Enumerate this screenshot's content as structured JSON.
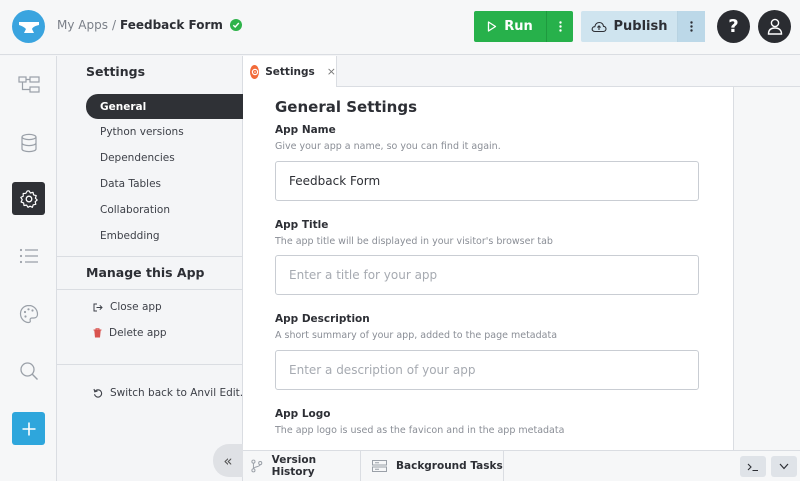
{
  "header": {
    "breadcrumb_root": "My Apps",
    "breadcrumb_sep": "/",
    "app_name": "Feedback Form",
    "run_label": "Run",
    "publish_label": "Publish",
    "help_label": "?"
  },
  "rail": {
    "icons": [
      "app-tree-icon",
      "database-icon",
      "gear-icon",
      "list-icon",
      "palette-icon",
      "search-icon",
      "plus-icon"
    ],
    "active": "gear-icon"
  },
  "nav": {
    "title": "Settings",
    "items": [
      {
        "label": "General",
        "active": true
      },
      {
        "label": "Python versions"
      },
      {
        "label": "Dependencies"
      },
      {
        "label": "Data Tables"
      },
      {
        "label": "Collaboration"
      },
      {
        "label": "Embedding"
      }
    ],
    "manage_title": "Manage this App",
    "close_app": "Close app",
    "delete_app": "Delete app",
    "switch_back": "Switch back to Anvil Edit..."
  },
  "tab": {
    "label": "Settings",
    "close": "×"
  },
  "main": {
    "heading": "General Settings",
    "app_name_label": "App Name",
    "app_name_help": "Give your app a name, so you can find it again.",
    "app_name_value": "Feedback Form",
    "app_title_label": "App Title",
    "app_title_help": "The app title will be displayed in your visitor's browser tab",
    "app_title_placeholder": "Enter a title for your app",
    "app_desc_label": "App Description",
    "app_desc_help": "A short summary of your app, added to the page metadata",
    "app_desc_placeholder": "Enter a description of your app",
    "app_logo_label": "App Logo",
    "app_logo_help": "The app logo is used as the favicon and in the app metadata"
  },
  "bottom": {
    "version_history": "Version History",
    "background_tasks": "Background Tasks",
    "collapse": "«"
  },
  "colors": {
    "run_green": "#27b14b",
    "accent_blue": "#2ea6dc",
    "settings_orange": "#f26b3a"
  }
}
